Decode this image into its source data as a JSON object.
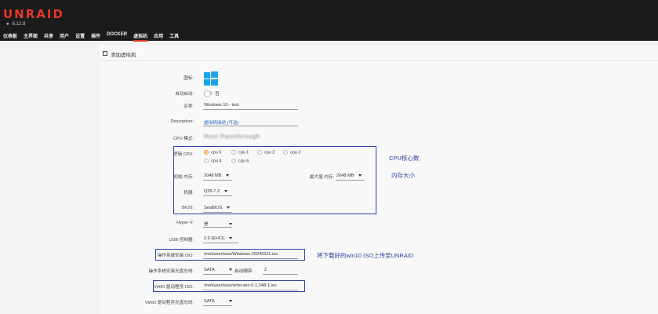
{
  "header": {
    "logo": "UNRAID",
    "version": "6.12.8",
    "nav": [
      "仪表板",
      "主界面",
      "共享",
      "用户",
      "设置",
      "插件",
      "DOCKER",
      "虚拟机",
      "应用",
      "工具"
    ],
    "active_nav": "虚拟机"
  },
  "panel": {
    "title": "添加虚拟机"
  },
  "form": {
    "icon_label": "图标:",
    "autostart_label": "自动启动:",
    "autostart_value": "否",
    "name_label": "名称:",
    "name_value": "Windows 10 - test",
    "description_label": "Description:",
    "description_value": "虚拟机描述 (可选)",
    "cpu_mode_label": "CPU 模式:",
    "cpu_mode_value": "Host Passthrough",
    "logical_cpu_label": "逻辑 CPU:",
    "cpus": [
      "cpu 0",
      "cpu 1",
      "cpu 2",
      "cpu 3",
      "cpu 4",
      "cpu 5"
    ],
    "selected_cpu": "cpu 0",
    "init_mem_label": "初始 内存:",
    "init_mem_value": "2048 MB",
    "max_mem_label": "最大值 内存:",
    "max_mem_value": "2048 MB",
    "machine_label": "机器:",
    "machine_value": "Q35-7.2",
    "bios_label": "BIOS:",
    "bios_value": "SeaBIOS",
    "hyperv_label": "Hyper-V:",
    "hyperv_value": "是",
    "usb_label": "USB 控制器:",
    "usb_value": "2.0 (EHCI)",
    "os_iso_label": "操作系统安装 ISO:",
    "os_iso_value": "/mnt/user/isos/Windows-20240311.iso",
    "os_bus_label": "操作系统安装光盘总线:",
    "os_bus_value": "SATA",
    "boot_order_label": "启动顺序:",
    "boot_order_value": "2",
    "virtio_iso_label": "VirtIO 驱动程序 ISO:",
    "virtio_iso_value": "/mnt/user/isos/virtio-win-0.1.248-1.iso",
    "virtio_bus_label": "VirtIO 驱动程序光盘总线:",
    "virtio_bus_value": "SATA"
  },
  "annotations": {
    "cpu_count": "CPU核心数",
    "memory_size": "内存大小",
    "upload_note": "将下载好的win10 ISO上传至UNRAID"
  },
  "colors": {
    "brand": "#e4372a",
    "annotation": "#2a3fa0",
    "radio_selected": "#f08a24",
    "windows_logo": "#1aa3e8"
  }
}
